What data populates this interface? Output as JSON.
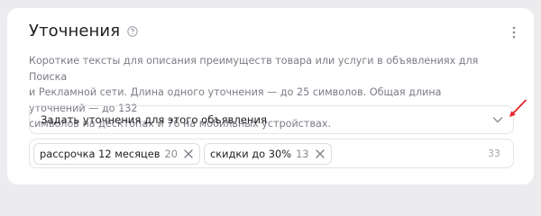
{
  "section": {
    "title": "Уточнения",
    "help_icon": "question-circle-icon",
    "more_icon": "vertical-dots-icon",
    "description_lines": [
      "Короткие тексты для описания преимуществ товара или услуги в объявлениях для Поиска",
      "и Рекламной сети. Длина одного уточнения — до 25 символов. Общая длина уточнений — до 132",
      "символов на десктопах и 76 на мобильных устройствах."
    ]
  },
  "select": {
    "label": "Задать уточнения для этого объявления",
    "icon": "chevron-down-icon"
  },
  "annotation": {
    "icon": "red-arrow-icon",
    "color": "#e3262b"
  },
  "chips": [
    {
      "label": "рассрочка 12 месяцев",
      "count": "20"
    },
    {
      "label": "скидки до 30%",
      "count": "13"
    }
  ],
  "total_count": "33",
  "colors": {
    "text": "#1f1f22",
    "muted": "#7b7d85",
    "border": "#e3e4e8",
    "background": "#ececef"
  }
}
